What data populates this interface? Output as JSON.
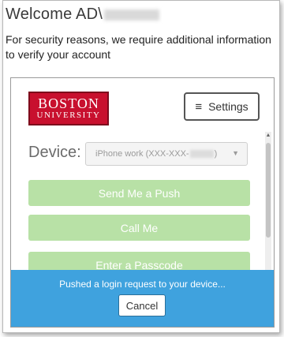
{
  "header": {
    "welcome_prefix": "Welcome AD\\",
    "message": "For security reasons, we require additional information to verify your account"
  },
  "logo": {
    "line1": "BOSTON",
    "line2": "UNIVERSITY"
  },
  "settings": {
    "label": "Settings",
    "icon": "hamburger-icon"
  },
  "device": {
    "label": "Device:",
    "selected": "iPhone work (XXX-XXX-",
    "selected_suffix": ")"
  },
  "actions": {
    "push": "Send Me a Push",
    "call": "Call Me",
    "passcode": "Enter a Passcode"
  },
  "status": {
    "message": "Pushed a login request to your device...",
    "cancel_label": "Cancel"
  },
  "colors": {
    "brand_red": "#c8102e",
    "action_green": "#b8e1a6",
    "status_blue": "#3fa2de"
  }
}
